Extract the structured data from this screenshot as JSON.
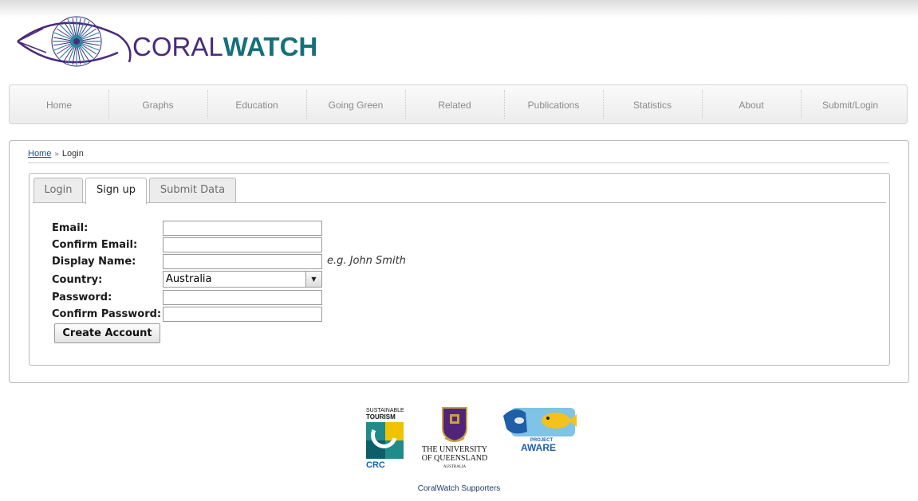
{
  "logo": {
    "text_coral": "CORAL",
    "text_watch": "WATCH"
  },
  "nav": {
    "items": [
      {
        "label": "Home"
      },
      {
        "label": "Graphs"
      },
      {
        "label": "Education"
      },
      {
        "label": "Going Green"
      },
      {
        "label": "Related"
      },
      {
        "label": "Publications"
      },
      {
        "label": "Statistics"
      },
      {
        "label": "About"
      },
      {
        "label": "Submit/Login"
      }
    ]
  },
  "breadcrumb": {
    "home": "Home",
    "separator": "»",
    "current": "Login"
  },
  "tabs": [
    {
      "label": "Login",
      "active": false
    },
    {
      "label": "Sign up",
      "active": true
    },
    {
      "label": "Submit Data",
      "active": false
    }
  ],
  "form": {
    "email_label": "Email:",
    "confirm_email_label": "Confirm Email:",
    "display_name_label": "Display Name:",
    "display_name_hint": "e.g. John Smith",
    "country_label": "Country:",
    "country_value": "Australia",
    "password_label": "Password:",
    "confirm_password_label": "Confirm Password:",
    "submit_label": "Create Account"
  },
  "footer": {
    "caption": "CoralWatch Supporters",
    "stcrc": {
      "line1": "SUSTAINABLE",
      "line2": "TOURISM",
      "line3": "CRC"
    },
    "uq": {
      "line1": "THE UNIVERSITY",
      "line2": "OF QUEENSLAND",
      "line3": "AUSTRALIA"
    },
    "aware": {
      "line1": "PROJECT",
      "line2": "AWARE"
    }
  },
  "colors": {
    "brand_purple": "#4a2a7c",
    "brand_teal": "#16707a",
    "link_blue": "#1c4e8a"
  }
}
